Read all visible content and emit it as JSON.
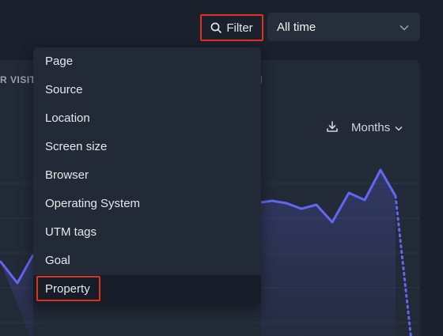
{
  "toolbar": {
    "filter_label": "Filter",
    "period_value": "All time"
  },
  "panel": {
    "heading_left": "R VISIT",
    "heading_right": "I",
    "interval_label": "Months"
  },
  "filter_menu": {
    "items": [
      {
        "label": "Page"
      },
      {
        "label": "Source"
      },
      {
        "label": "Location"
      },
      {
        "label": "Screen size"
      },
      {
        "label": "Browser"
      },
      {
        "label": "Operating System"
      },
      {
        "label": "UTM tags"
      },
      {
        "label": "Goal"
      },
      {
        "label": "Property"
      }
    ],
    "active_index": 8
  },
  "colors": {
    "background": "#1a202c",
    "panel": "#222a38",
    "line": "#6366f1",
    "highlight": "#e0311c"
  },
  "icons": {
    "filter": "search-icon",
    "period": "chevron-down-icon",
    "download": "download-icon",
    "interval": "chevron-down-icon"
  }
}
